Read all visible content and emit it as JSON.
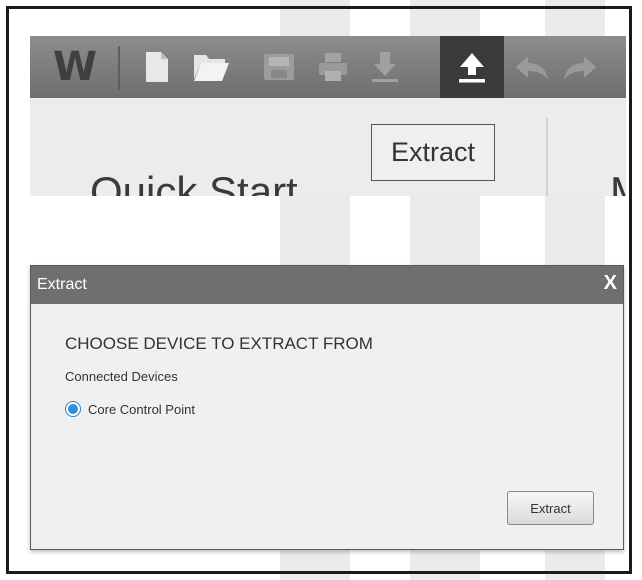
{
  "toolbar": {
    "logo": "W",
    "buttons": [
      {
        "name": "new-document-icon",
        "active": false
      },
      {
        "name": "open-folder-icon",
        "active": false
      },
      {
        "name": "save-icon",
        "active": false
      },
      {
        "name": "print-icon",
        "active": false
      },
      {
        "name": "download-icon",
        "active": false
      },
      {
        "name": "upload-extract-icon",
        "active": true
      },
      {
        "name": "undo-icon",
        "active": false
      },
      {
        "name": "redo-icon",
        "active": false
      }
    ],
    "active_color": "#3b3b3b"
  },
  "tooltip": {
    "text": "Extract"
  },
  "content": {
    "title": "Quick Start",
    "next_title_partial": "M"
  },
  "dialog": {
    "title": "Extract",
    "close_label": "X",
    "heading": "CHOOSE DEVICE TO EXTRACT FROM",
    "subheading": "Connected Devices",
    "devices": [
      {
        "label": "Core Control Point",
        "selected": true
      }
    ],
    "extract_button": "Extract"
  }
}
